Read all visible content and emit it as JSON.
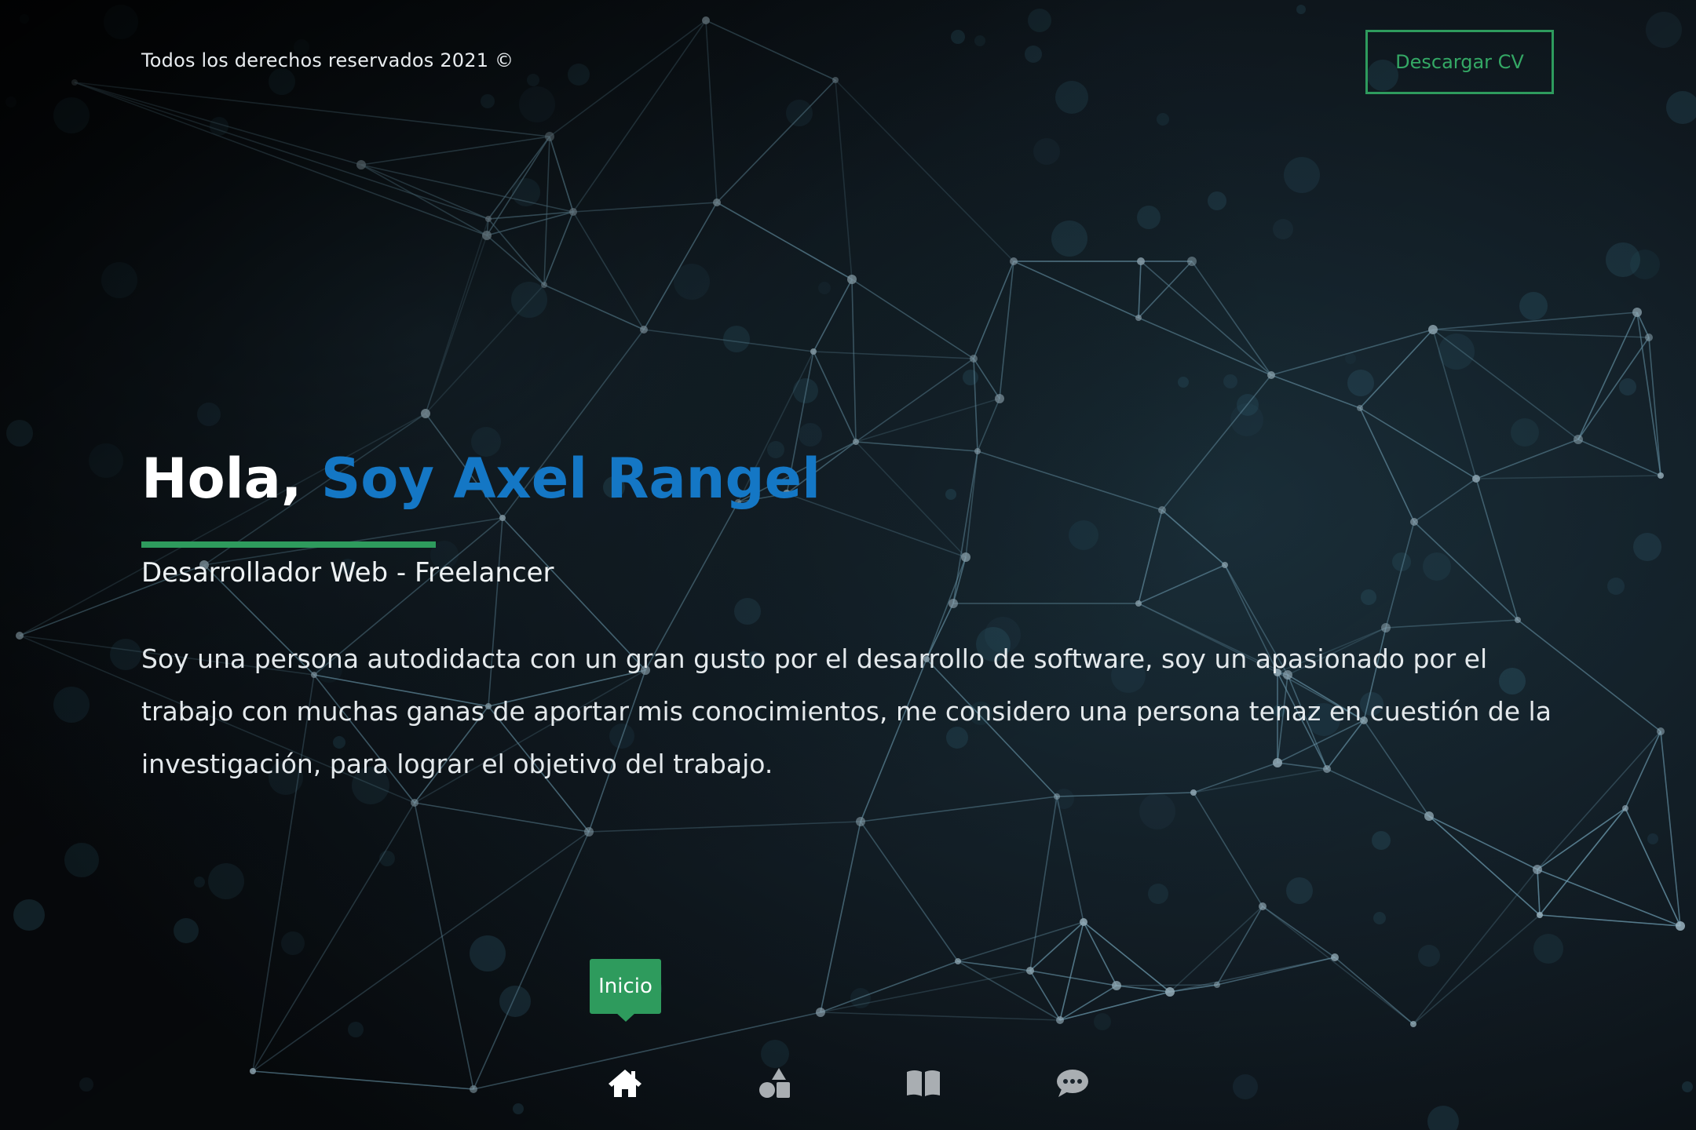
{
  "header": {
    "copyright": "Todos los derechos reservados 2021 ©",
    "cv_button": "Descargar CV"
  },
  "hero": {
    "greeting": "Hola, ",
    "name": "Soy Axel Rangel",
    "subtitle": "Desarrollador Web - Freelancer",
    "description": "Soy una persona autodidacta con un gran gusto por el desarrollo de software, soy un apasionado por el trabajo con muchas ganas de aportar mis conocimientos, me considero una persona tenaz en cuestión de la investigación, para lograr el objetivo del trabajo."
  },
  "nav": {
    "tooltip": "Inicio",
    "items": [
      {
        "icon": "home-icon",
        "active": true
      },
      {
        "icon": "shapes-icon",
        "active": false
      },
      {
        "icon": "book-icon",
        "active": false
      },
      {
        "icon": "chat-icon",
        "active": false
      }
    ]
  },
  "colors": {
    "accent_green": "#2e9b5d",
    "accent_blue": "#1477c5",
    "background": "#0c1218",
    "network": "#6f9fb4"
  }
}
